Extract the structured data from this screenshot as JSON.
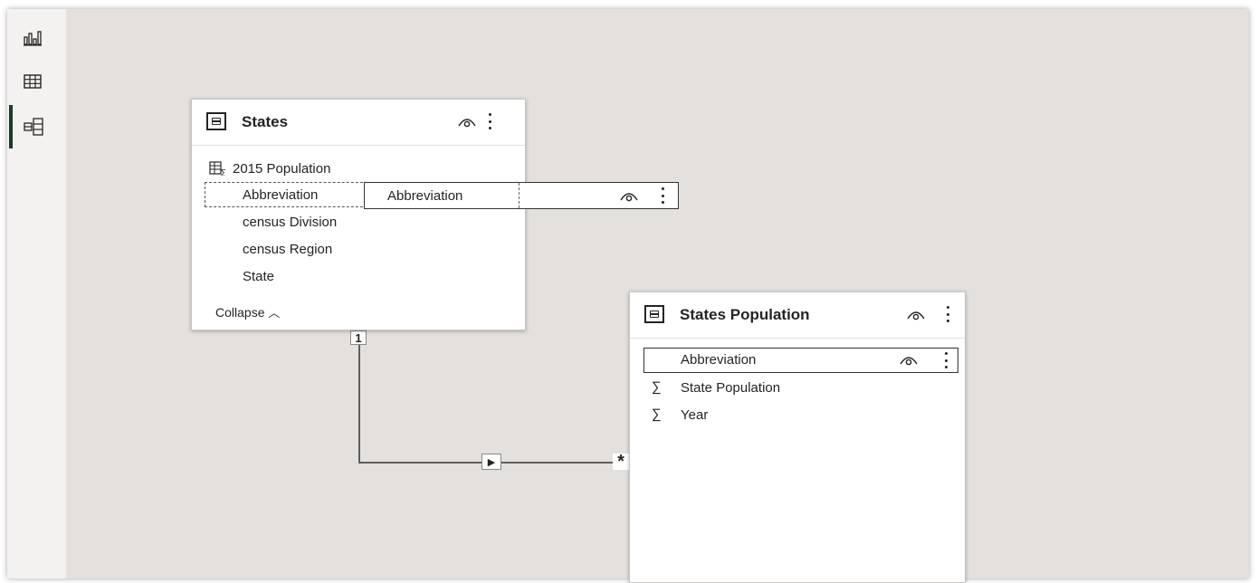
{
  "rail": {
    "items": [
      {
        "name": "report-view",
        "icon": "bar-chart-icon"
      },
      {
        "name": "table-view",
        "icon": "grid-icon"
      },
      {
        "name": "model-view",
        "icon": "model-icon",
        "active": true
      }
    ],
    "active_color": "#1e3a2b"
  },
  "states_table": {
    "title": "States",
    "fields": [
      {
        "label": "2015 Population",
        "icon": "hierarchy-sigma-icon"
      },
      {
        "label": "Abbreviation",
        "icon": ""
      },
      {
        "label": "census Division",
        "icon": ""
      },
      {
        "label": "census Region",
        "icon": ""
      },
      {
        "label": "State",
        "icon": ""
      }
    ],
    "collapse_label": "Collapse",
    "collapse_glyph": "︿"
  },
  "drag_ghost": {
    "label": "Abbreviation"
  },
  "population_table": {
    "title": "States Population",
    "fields": [
      {
        "label": "Abbreviation",
        "icon": ""
      },
      {
        "label": "State Population",
        "icon": "sigma-icon"
      },
      {
        "label": "Year",
        "icon": "sigma-icon"
      }
    ]
  },
  "relationship": {
    "one_label": "1",
    "many_label": "*",
    "direction_glyph": "▶"
  },
  "glyphs": {
    "sigma": "∑"
  }
}
